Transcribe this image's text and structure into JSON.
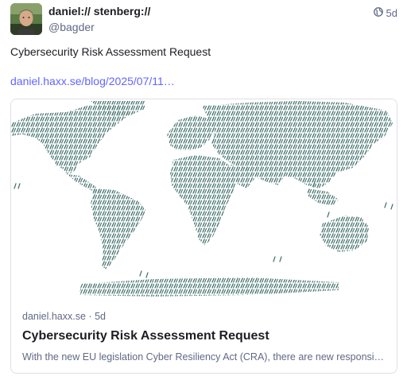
{
  "author": {
    "display_name": "daniel:// stenberg://",
    "handle": "@bagder",
    "avatar_icon": "user-avatar-photo"
  },
  "post": {
    "relative_time": "5d",
    "visibility_icon": "globe-icon",
    "text": "Cybersecurity Risk Assessment Request",
    "link_text": "daniel.haxx.se/blog/2025/07/11…"
  },
  "link_card": {
    "image_icon": "world-map-icon",
    "domain": "daniel.haxx.se",
    "separator": "·",
    "age": "5d",
    "title": "Cybersecurity Risk Assessment Request",
    "description": "With the new EU legislation Cyber Resiliency Act (CRA), there are new responsibilitie…"
  },
  "colors": {
    "link": "#6364ff",
    "muted": "#606984",
    "map_marks": "#3f6f6a"
  }
}
